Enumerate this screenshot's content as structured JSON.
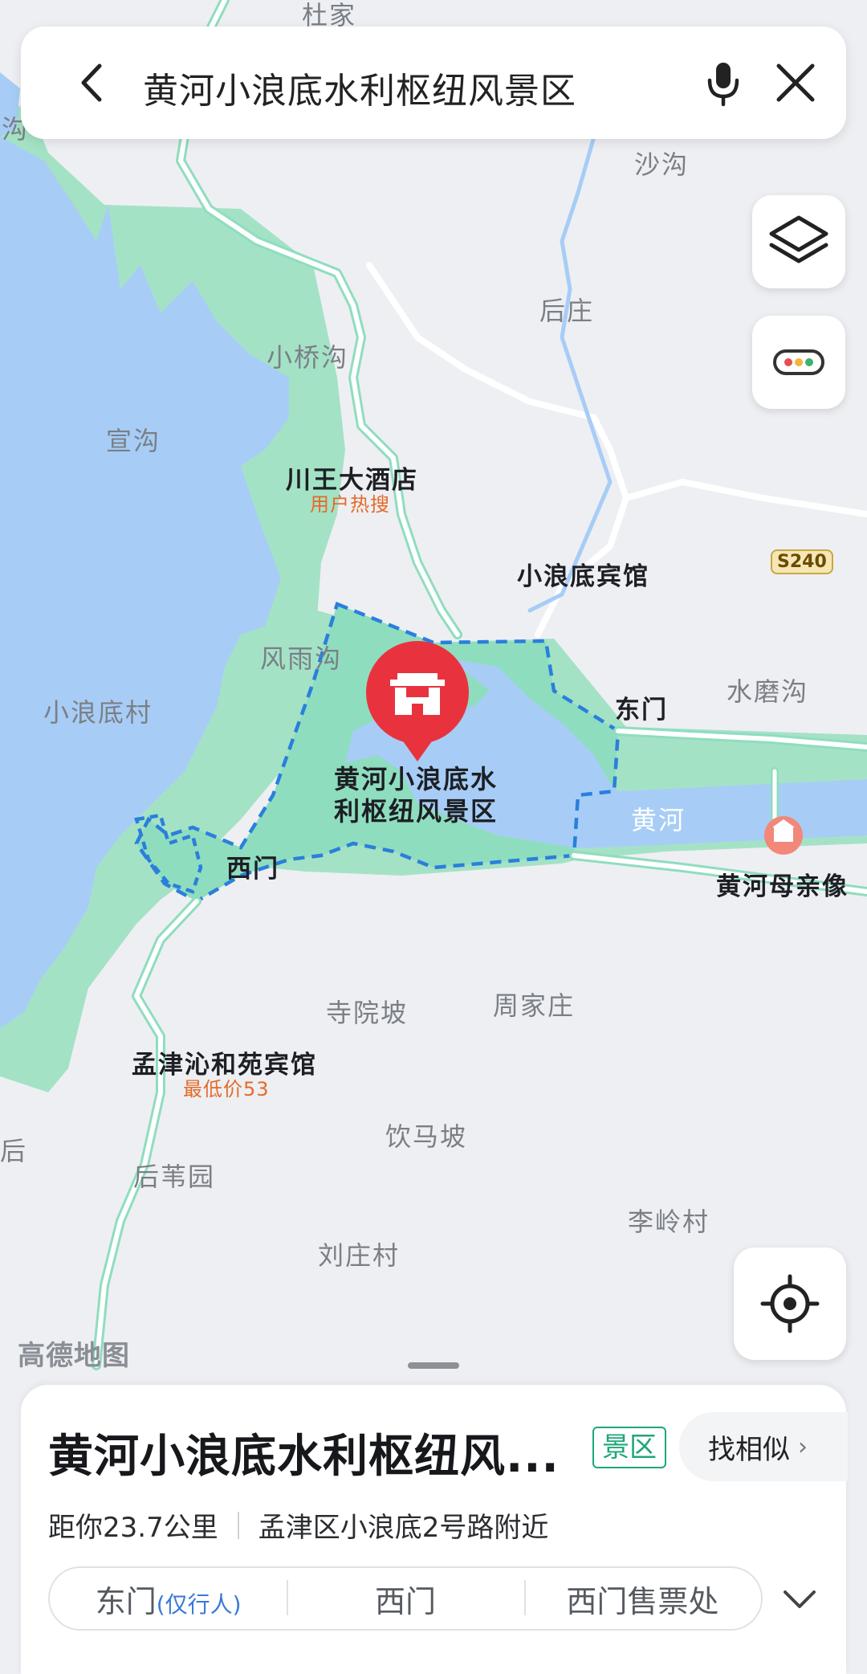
{
  "search": {
    "query": "黄河小浪底水利枢纽风景区"
  },
  "map": {
    "colors": {
      "water": "#a7cdf6",
      "green": "#a4e2c6",
      "scenic_area": "#8fddbf",
      "boundary": "#2a7fdc",
      "marker": "#e8333f",
      "road": "#ffffff"
    },
    "place_labels": [
      "沙沟",
      "后庄",
      "小桥沟",
      "宣沟",
      "风雨沟",
      "小浪底村",
      "水磨沟",
      "寺院坡",
      "周家庄",
      "饮马坡",
      "后苇园",
      "李岭村",
      "刘庄村"
    ],
    "poi_labels": [
      "川王大酒店",
      "小浪底宾馆",
      "东门",
      "西门",
      "黄河母亲像",
      "孟津沁和苑宾馆"
    ],
    "poi_sublabels": [
      "用户热搜",
      "最低价53"
    ],
    "river_label": "黄河",
    "road_shield": "S240",
    "edge_fragments": [
      "杜家",
      "沟",
      "后"
    ],
    "selected_marker": {
      "label_line1": "黄河小浪底水",
      "label_line2": "利枢纽风景区",
      "icon": "scenic-gate-icon"
    },
    "watermark": "高德地图"
  },
  "controls": {
    "layers_icon": "layers-icon",
    "traffic_icon": "traffic-toggle-icon",
    "locate_icon": "locate-icon"
  },
  "card": {
    "title": "黄河小浪底水利枢纽风...",
    "badge": "景区",
    "similar_button": "找相似",
    "distance": "距你23.7公里",
    "address": "孟津区小浪底2号路附近",
    "gates": [
      {
        "label": "东门",
        "note": "(仅行人)"
      },
      {
        "label": "西门",
        "note": ""
      },
      {
        "label": "西门售票处",
        "note": ""
      }
    ]
  }
}
